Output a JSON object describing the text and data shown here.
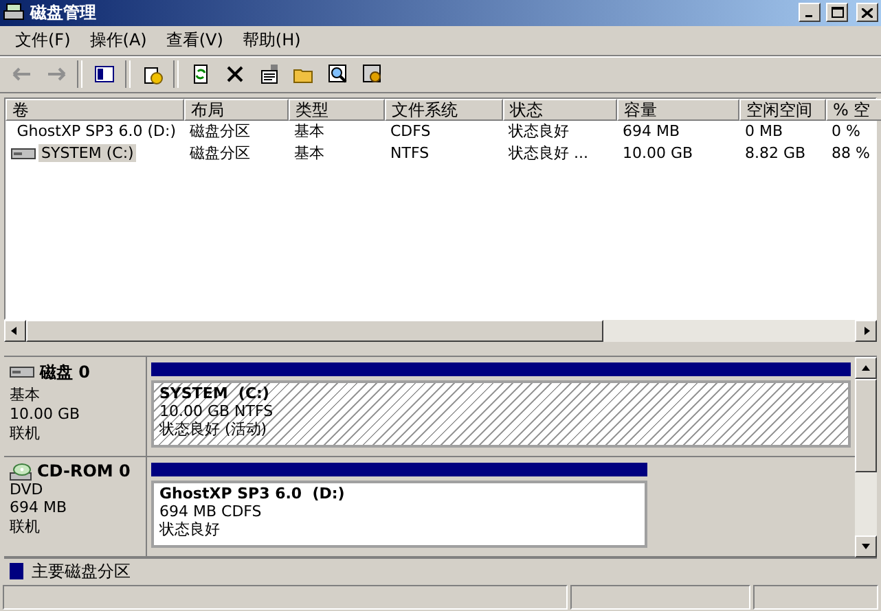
{
  "window": {
    "title": "磁盘管理"
  },
  "menu": [
    "文件(F)",
    "操作(A)",
    "查看(V)",
    "帮助(H)"
  ],
  "toolbar": [
    {
      "kind": "back",
      "disabled": true
    },
    {
      "kind": "forward",
      "disabled": true
    },
    {
      "kind": "sep"
    },
    {
      "kind": "tree"
    },
    {
      "kind": "sep"
    },
    {
      "kind": "help"
    },
    {
      "kind": "sep"
    },
    {
      "kind": "refresh"
    },
    {
      "kind": "delete"
    },
    {
      "kind": "properties"
    },
    {
      "kind": "open"
    },
    {
      "kind": "explore"
    },
    {
      "kind": "settings"
    }
  ],
  "table": {
    "columns": [
      "卷",
      "布局",
      "类型",
      "文件系统",
      "状态",
      "容量",
      "空闲空间",
      "% 空"
    ],
    "rows": [
      {
        "kind": "cd",
        "selected": false,
        "cells": [
          "GhostXP SP3 6.0 (D:)",
          "磁盘分区",
          "基本",
          "CDFS",
          "状态良好",
          "694 MB",
          "0 MB",
          "0 %"
        ]
      },
      {
        "kind": "disk",
        "selected": true,
        "cells": [
          "SYSTEM (C:)",
          "磁盘分区",
          "基本",
          "NTFS",
          "状态良好 ...",
          "10.00 GB",
          "8.82 GB",
          "88 %"
        ]
      }
    ]
  },
  "disks": [
    {
      "kind": "disk",
      "name": "磁盘 0",
      "type": "基本",
      "size": "10.00 GB",
      "status": "联机",
      "volume": {
        "title": "SYSTEM  (C:)",
        "detail": "10.00 GB NTFS",
        "status": "状态良好 (活动)",
        "hatched": true
      }
    },
    {
      "kind": "cd",
      "name": "CD-ROM 0",
      "type": "DVD",
      "size": "694 MB",
      "status": "联机",
      "volume": {
        "title": "GhostXP SP3 6.0  (D:)",
        "detail": "694 MB CDFS",
        "status": "状态良好",
        "hatched": false
      }
    }
  ],
  "legend": [
    {
      "label": "主要磁盘分区",
      "color": "#000080"
    }
  ]
}
